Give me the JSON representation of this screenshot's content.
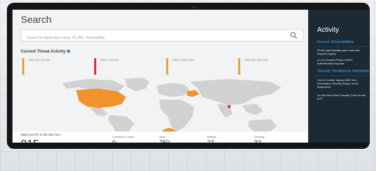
{
  "search": {
    "title": "Search",
    "placeholder": "Search for Application name, IP, URL, Vulnerability..."
  },
  "threats": {
    "heading": "Current Threat Activity",
    "cards": [
      {
        "ip": "192.162.110.80",
        "color": "#e6a23c"
      },
      {
        "ip": "209.4.173.52",
        "color": "#d9342b"
      },
      {
        "ip": "229.73.203.154",
        "color": "#e6a23c"
      },
      {
        "ip": "208.215.190.180",
        "color": "#e6a23c"
      }
    ]
  },
  "stats": {
    "malicious_label": "Malicious IPs in the last hour",
    "malicious_count": "815",
    "items": [
      {
        "label": "Command & Control",
        "value": "0"
      },
      {
        "label": "Spam",
        "value": "750"
      },
      {
        "label": "Malware",
        "value": "22"
      },
      {
        "label": "Scanning",
        "value": "32"
      }
    ]
  },
  "activity": {
    "title": "Activity",
    "recent_heading": "Recent Vulnerabilities",
    "recent_items": [
      "eFront administrator.php cross-site request forgery",
      "LG On-Screen Phone (OSP) authentication bypass"
    ],
    "intel_heading": "Security Intelligence Highlights",
    "intel_items": [
      "How to Create Impact With Your Information Security Report in the Boardroom",
      "Do We Need New Security Tools for the IoT?"
    ]
  },
  "colors": {
    "sidebar_bg": "#1c2a36",
    "accent_blue": "#4fa3ea",
    "threat_orange": "#f0932a",
    "threat_red": "#d9342b",
    "map_land": "#cfd1d3"
  }
}
